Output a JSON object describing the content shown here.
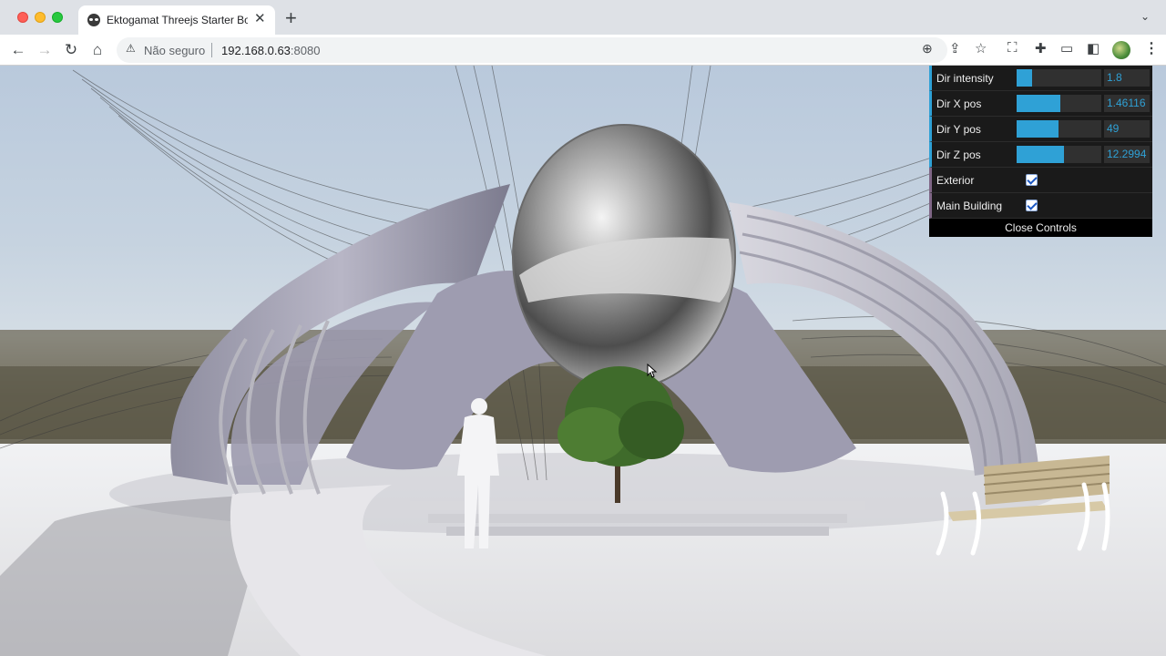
{
  "browser": {
    "tab_title": "Ektogamat Threejs Starter Boilerplate",
    "tab_close": "✕",
    "new_tab": "+",
    "tab_menu": "⌄",
    "nav": {
      "back": "←",
      "forward": "→",
      "reload": "↻",
      "home": "⌂"
    },
    "address": {
      "security_icon": "⚠",
      "security_label": "Não seguro",
      "host": "192.168.0.63",
      "port": ":8080"
    },
    "icons": {
      "zoom": "⊕",
      "share": "⇪",
      "bookmark": "☆",
      "screenshot": "⛶",
      "extensions": "✚",
      "cast": "▭",
      "sidepanel": "◧",
      "menu": "⋮"
    }
  },
  "gui": {
    "accent": "#2fa1d6",
    "controls": [
      {
        "label": "Dir intensity",
        "value": "1.8",
        "fill": 0.18
      },
      {
        "label": "Dir X pos",
        "value": "1.46116",
        "fill": 0.52
      },
      {
        "label": "Dir Y pos",
        "value": "49",
        "fill": 0.49
      },
      {
        "label": "Dir Z pos",
        "value": "12.2994",
        "fill": 0.56
      }
    ],
    "toggles": [
      {
        "label": "Exterior",
        "checked": true
      },
      {
        "label": "Main Building",
        "checked": true
      }
    ],
    "close_label": "Close Controls"
  }
}
